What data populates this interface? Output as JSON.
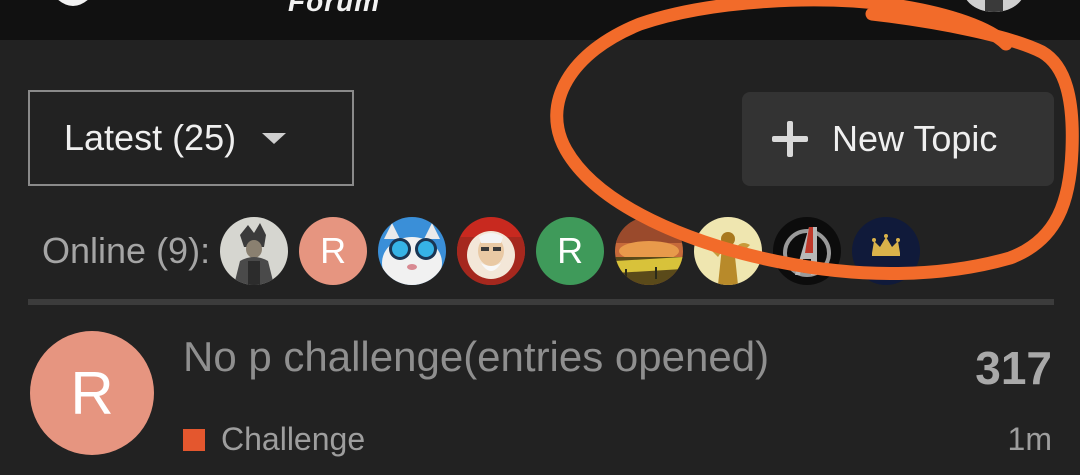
{
  "header": {
    "site_title": "Forum"
  },
  "filter": {
    "label": "Latest (25)"
  },
  "new_topic": {
    "label": "New Topic"
  },
  "online": {
    "label": "Online (9):",
    "avatars": [
      {
        "kind": "image",
        "icon": "anime-warrior-avatar"
      },
      {
        "kind": "letter",
        "letter": "R",
        "color": "#e69580"
      },
      {
        "kind": "image",
        "icon": "cat-sunglasses-avatar"
      },
      {
        "kind": "image",
        "icon": "colonel-logo-avatar"
      },
      {
        "kind": "letter",
        "letter": "R",
        "color": "#3f9a5a"
      },
      {
        "kind": "image",
        "icon": "sunset-landscape-avatar"
      },
      {
        "kind": "image",
        "icon": "golden-statue-avatar"
      },
      {
        "kind": "image",
        "icon": "avengers-logo-avatar"
      },
      {
        "kind": "image",
        "icon": "crown-avatar"
      }
    ]
  },
  "topics": [
    {
      "avatar_letter": "R",
      "avatar_color": "#e69580",
      "title": "No p challenge(entries opened)",
      "replies": "317",
      "category": "Challenge",
      "category_color": "#e4572e",
      "time": "1m"
    }
  ],
  "annotation": {
    "color": "#f26b2a"
  }
}
